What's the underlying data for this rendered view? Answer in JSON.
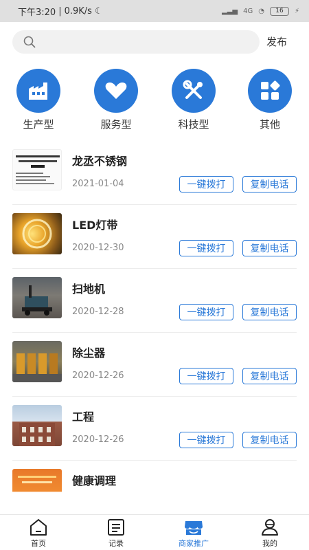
{
  "status": {
    "time": "下午3:20",
    "speed": "0.9K/s",
    "network": "4G",
    "battery": "16"
  },
  "search": {
    "placeholder": ""
  },
  "header": {
    "publish_label": "发布"
  },
  "categories": [
    {
      "label": "生产型",
      "icon": "factory-icon"
    },
    {
      "label": "服务型",
      "icon": "heart-icon"
    },
    {
      "label": "科技型",
      "icon": "tools-icon"
    },
    {
      "label": "其他",
      "icon": "apps-icon"
    }
  ],
  "list": {
    "call_label": "一键拨打",
    "copy_label": "复制电话",
    "items": [
      {
        "title": "龙丞不锈钢",
        "date": "2021-01-04"
      },
      {
        "title": "LED灯带",
        "date": "2020-12-30"
      },
      {
        "title": "扫地机",
        "date": "2020-12-28"
      },
      {
        "title": "除尘器",
        "date": "2020-12-26"
      },
      {
        "title": "工程",
        "date": "2020-12-26"
      },
      {
        "title": "健康调理",
        "date": ""
      }
    ]
  },
  "tabs": [
    {
      "label": "首页"
    },
    {
      "label": "记录"
    },
    {
      "label": "商家推广"
    },
    {
      "label": "我的"
    }
  ],
  "colors": {
    "accent": "#2a79d8",
    "status_bar": "#e0e0e0"
  }
}
